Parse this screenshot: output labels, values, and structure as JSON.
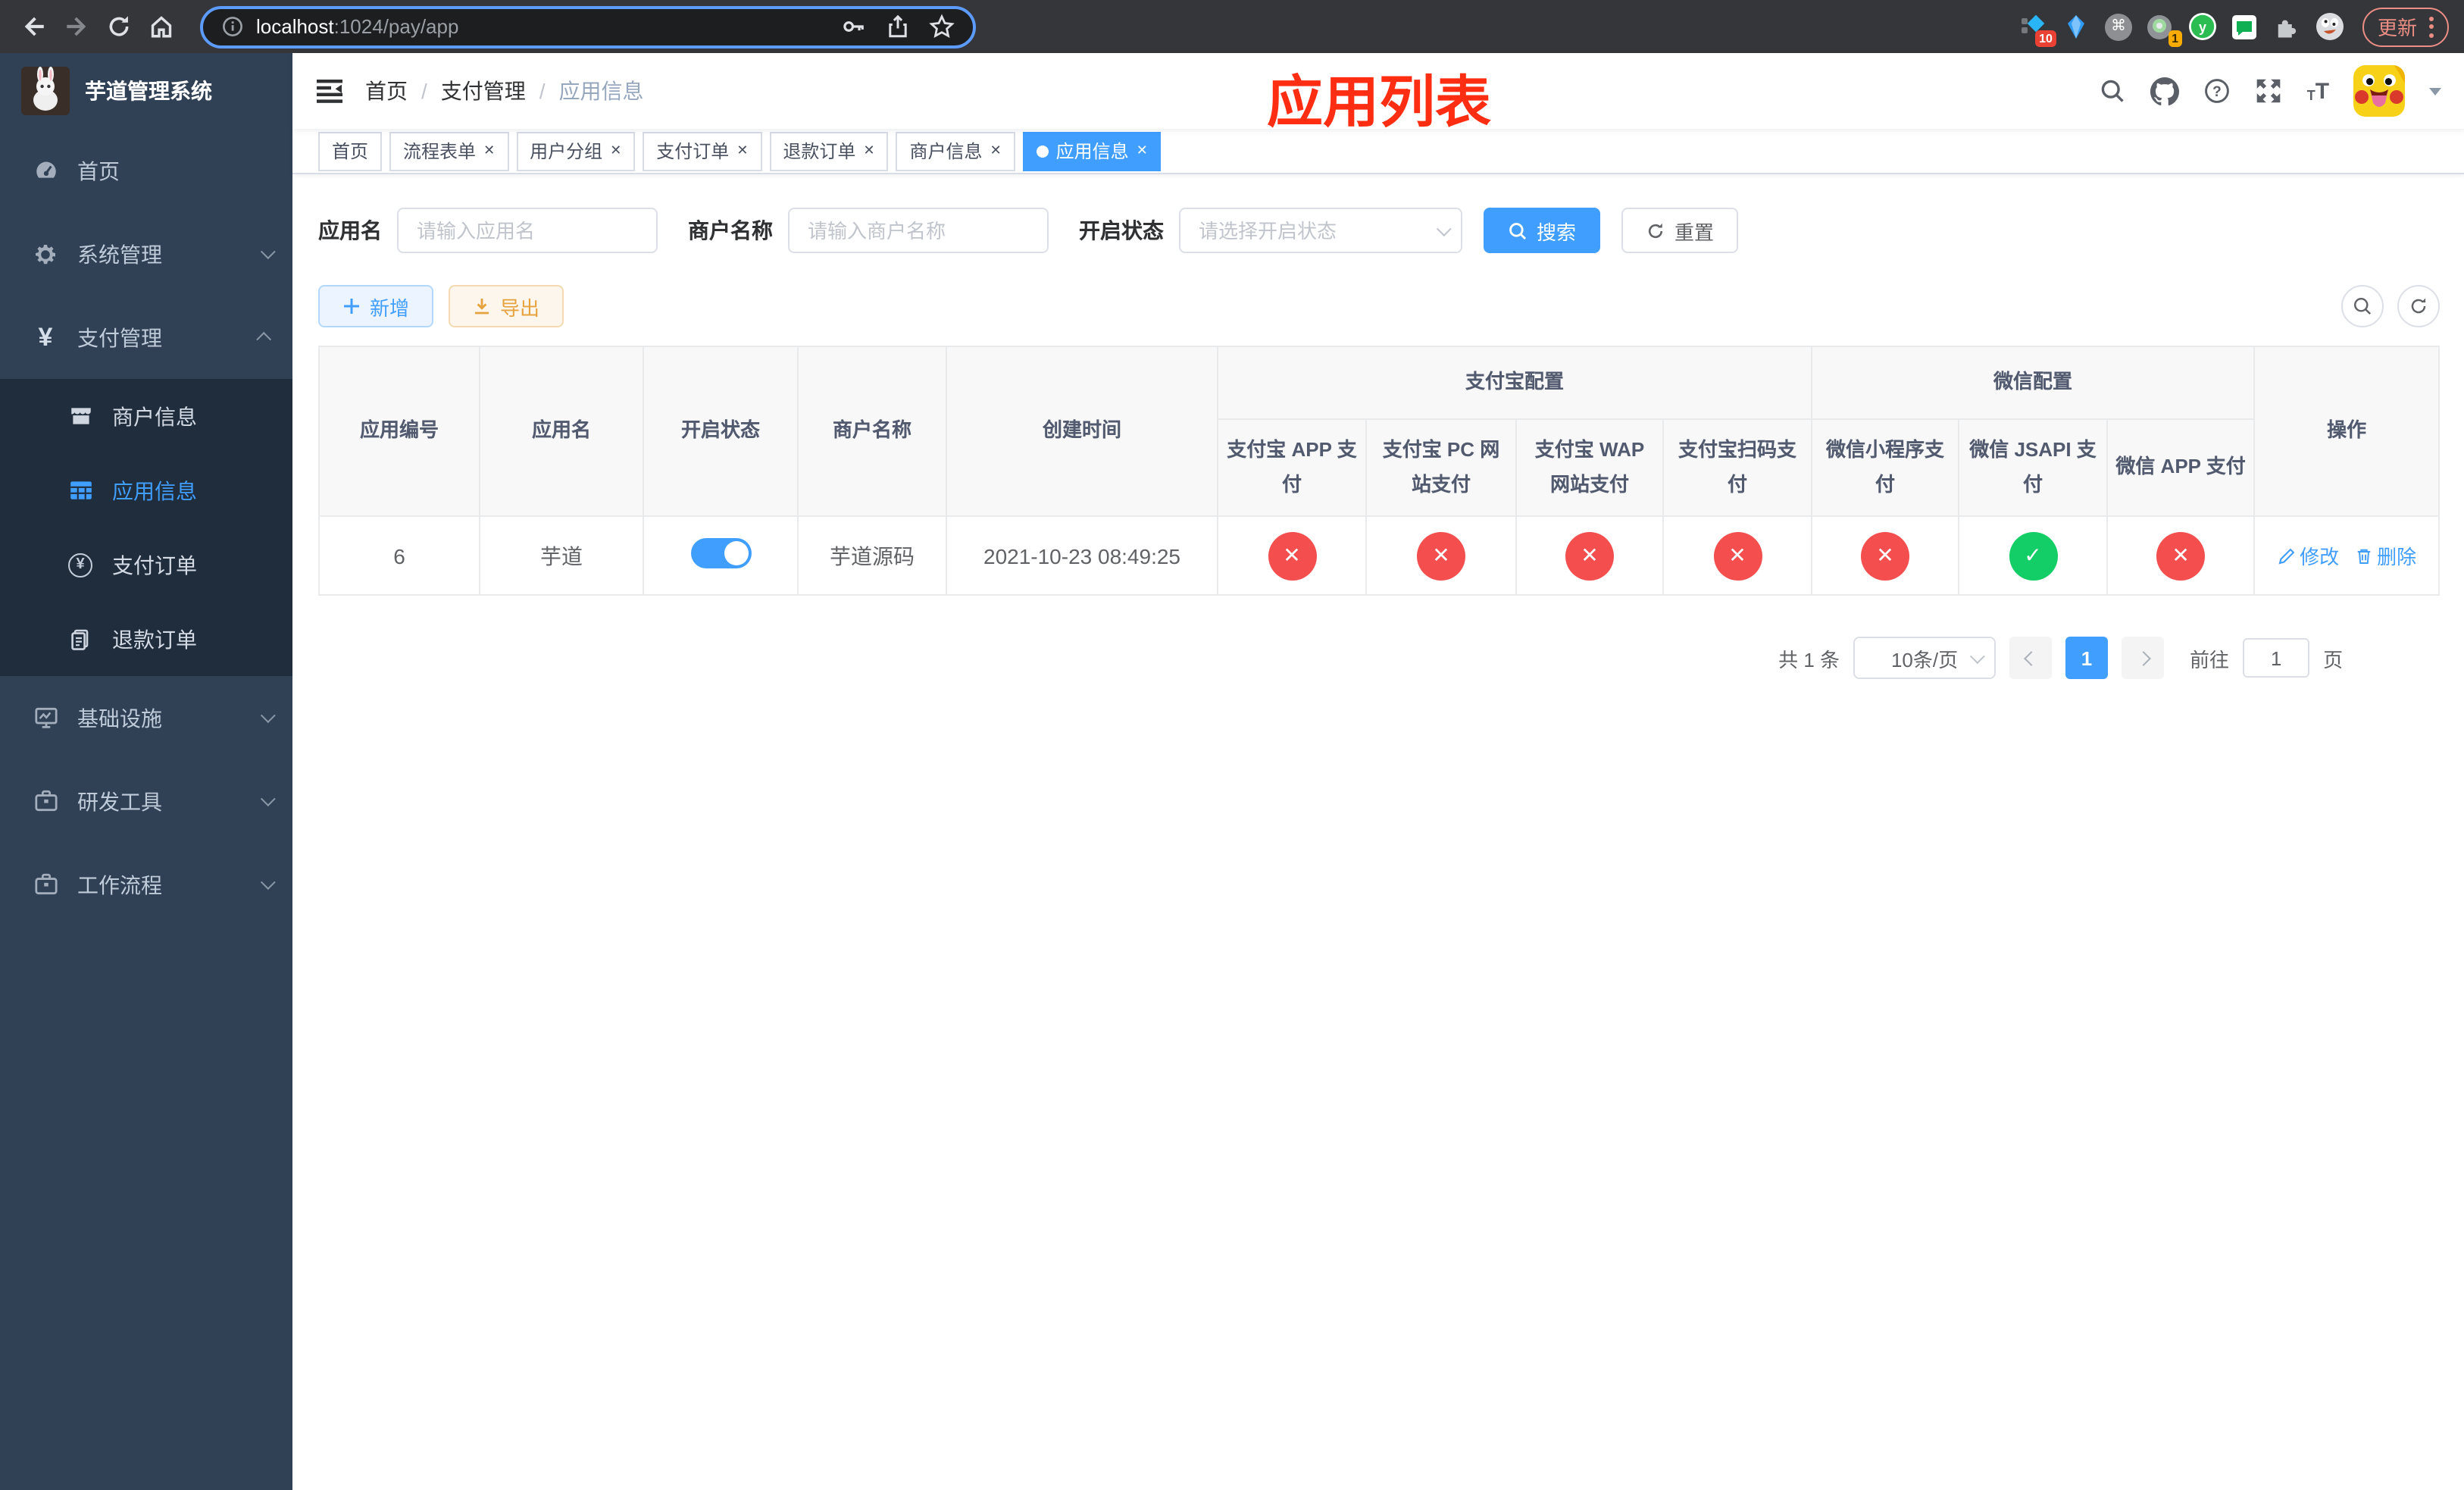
{
  "colors": {
    "accent": "#409eff",
    "danger": "#f44e4e",
    "success": "#13ce66",
    "sidebar_bg": "#304156",
    "submenu_bg": "#1f2d3d",
    "annotation_red": "#ff2e12"
  },
  "browser": {
    "url_host": "localhost",
    "url_path": ":1024/pay/app",
    "update_label": "更新",
    "ext_badge_pinned": "10",
    "ext_badge_recorder": "1",
    "ext_letter": "y"
  },
  "sidebar": {
    "title": "芋道管理系统",
    "items": [
      {
        "label": "首页",
        "icon": "dashboard-icon"
      },
      {
        "label": "系统管理",
        "icon": "gear-icon"
      },
      {
        "label": "支付管理",
        "icon": "yen-icon"
      },
      {
        "label": "商户信息",
        "icon": "store-icon"
      },
      {
        "label": "应用信息",
        "icon": "grid-icon"
      },
      {
        "label": "支付订单",
        "icon": "yen-circle-icon"
      },
      {
        "label": "退款订单",
        "icon": "document-icon"
      },
      {
        "label": "基础设施",
        "icon": "monitor-icon"
      },
      {
        "label": "研发工具",
        "icon": "briefcase-icon"
      },
      {
        "label": "工作流程",
        "icon": "briefcase-icon"
      }
    ]
  },
  "header": {
    "breadcrumb": {
      "a": "首页",
      "b": "支付管理",
      "c": "应用信息"
    },
    "annotation": "应用列表"
  },
  "tabs": [
    {
      "label": "首页"
    },
    {
      "label": "流程表单"
    },
    {
      "label": "用户分组"
    },
    {
      "label": "支付订单"
    },
    {
      "label": "退款订单"
    },
    {
      "label": "商户信息"
    },
    {
      "label": "应用信息"
    }
  ],
  "filters": {
    "app_name_label": "应用名",
    "app_name_placeholder": "请输入应用名",
    "merchant_label": "商户名称",
    "merchant_placeholder": "请输入商户名称",
    "status_label": "开启状态",
    "status_placeholder": "请选择开启状态",
    "search_label": "搜索",
    "reset_label": "重置"
  },
  "toolbar": {
    "add_label": "新增",
    "export_label": "导出"
  },
  "table": {
    "headers": {
      "app_id": "应用编号",
      "app_name": "应用名",
      "status": "开启状态",
      "merchant": "商户名称",
      "created": "创建时间",
      "alipay_group": "支付宝配置",
      "wechat_group": "微信配置",
      "actions": "操作",
      "sub": [
        "支付宝 APP 支付",
        "支付宝 PC 网站支付",
        "支付宝 WAP 网站支付",
        "支付宝扫码支付",
        "微信小程序支付",
        "微信 JSAPI 支付",
        "微信 APP 支付"
      ]
    },
    "row": {
      "id": "6",
      "name": "芋道",
      "enabled": true,
      "merchant": "芋道源码",
      "created": "2021-10-23 08:49:25",
      "channels": [
        false,
        false,
        false,
        false,
        false,
        true,
        false
      ],
      "edit_label": "修改",
      "delete_label": "删除"
    }
  },
  "pagination": {
    "total": "共 1 条",
    "page_size": "10条/页",
    "page": "1",
    "goto_label": "前往",
    "goto_value": "1",
    "page_suffix": "页"
  }
}
